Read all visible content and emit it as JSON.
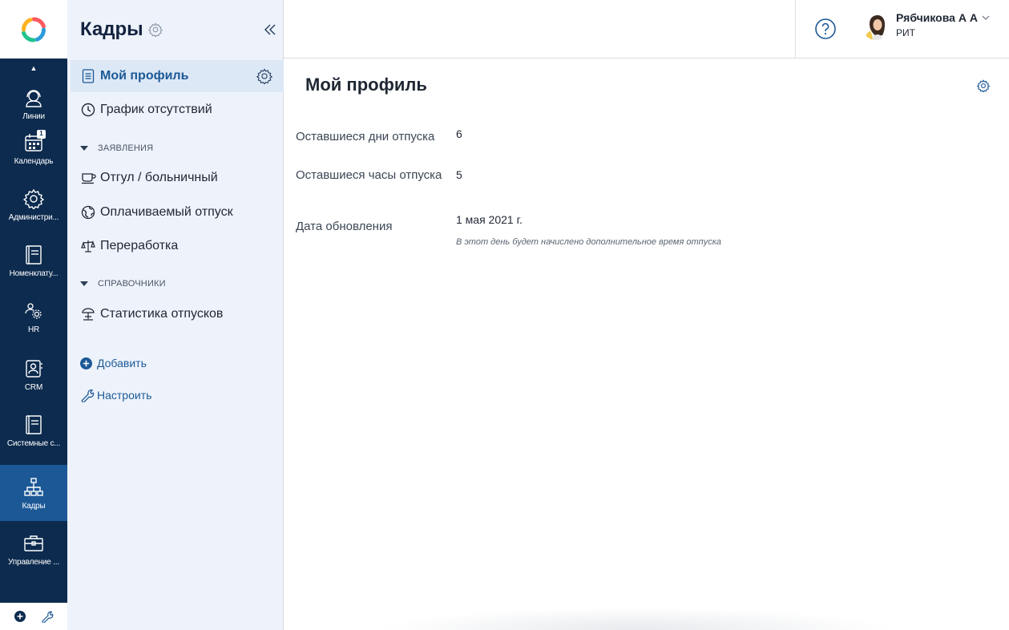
{
  "rail": {
    "items": [
      {
        "label": "Линии",
        "icon": "headset-icon"
      },
      {
        "label": "Календарь",
        "icon": "calendar-icon",
        "badge": "1"
      },
      {
        "label": "Администри...",
        "icon": "gear-icon"
      },
      {
        "label": "Номенклату...",
        "icon": "book-icon"
      },
      {
        "label": "HR",
        "icon": "people-gear-icon"
      },
      {
        "label": "CRM",
        "icon": "contact-book-icon"
      },
      {
        "label": "Системные с...",
        "icon": "book-icon"
      },
      {
        "label": "Кадры",
        "icon": "org-chart-icon",
        "active": true
      },
      {
        "label": "Управление ...",
        "icon": "briefcase-icon"
      }
    ]
  },
  "sidebar": {
    "title": "Кадры",
    "items": [
      {
        "label": "Мой профиль",
        "icon": "document-icon",
        "active": true
      },
      {
        "label": "График отсутствий",
        "icon": "clock-icon"
      }
    ],
    "group1": {
      "label": "ЗАЯВЛЕНИЯ"
    },
    "group1_items": [
      {
        "label": "Отгул / больничный",
        "icon": "cup-icon"
      },
      {
        "label": "Оплачиваемый отпуск",
        "icon": "globe-icon"
      },
      {
        "label": "Переработка",
        "icon": "scales-icon"
      }
    ],
    "group2": {
      "label": "СПРАВОЧНИКИ"
    },
    "group2_items": [
      {
        "label": "Статистика отпусков",
        "icon": "beach-umbrella-icon"
      }
    ],
    "add_label": "Добавить",
    "configure_label": "Настроить"
  },
  "header": {
    "user_name": "Рябчикова А А",
    "user_org": "РИТ"
  },
  "main": {
    "title": "Мой профиль",
    "fields": [
      {
        "label": "Оставшиеся дни отпуска",
        "value": "6"
      },
      {
        "label": "Оставшиеся часы отпуска",
        "value": "5"
      },
      {
        "label": "Дата обновления",
        "value": "1 мая 2021 г.",
        "hint": "В этот день будет начислено дополнительное время отпуска"
      }
    ]
  },
  "colors": {
    "rail_bg": "#0d2b4e",
    "rail_active": "#1c5896",
    "sidebar_bg": "#eef3fb",
    "accent": "#1c5896"
  }
}
